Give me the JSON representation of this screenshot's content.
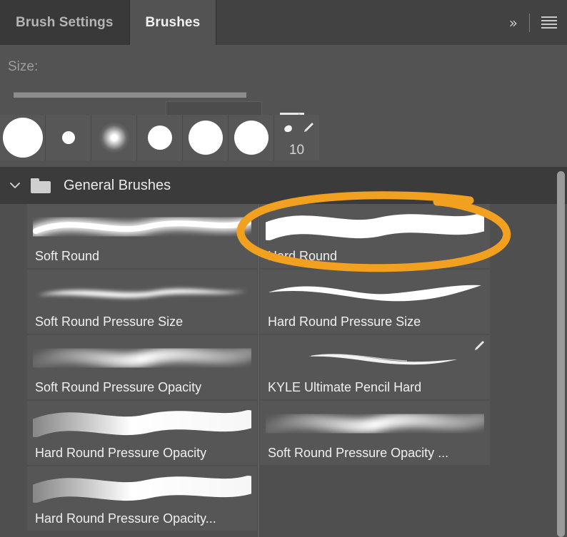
{
  "window": {
    "title": "Brushes",
    "bg_color": "#535353",
    "tabbar_color": "#424242"
  },
  "tabs": [
    {
      "label": "Brush Settings",
      "active": false
    },
    {
      "label": "Brushes",
      "active": true
    }
  ],
  "tab_tools": {
    "collapse_label": "»",
    "collapse_icon": "double-chevron-right-icon",
    "menu_icon": "hamburger-menu-icon"
  },
  "size_row": {
    "label": "Size:",
    "value": "",
    "placeholder": "",
    "slider_value": 100,
    "brush_preview_icon": "brush-preview-icon"
  },
  "preset_thumbs": [
    {
      "name": "hard-round-large",
      "kind": "hard",
      "diameter": 56,
      "label": ""
    },
    {
      "name": "hard-round-tiny",
      "kind": "hard",
      "diameter": 18,
      "label": ""
    },
    {
      "name": "soft-round",
      "kind": "soft",
      "diameter": 44,
      "label": ""
    },
    {
      "name": "hard-round-medium",
      "kind": "hard",
      "diameter": 34,
      "label": ""
    },
    {
      "name": "hard-round-big",
      "kind": "hard",
      "diameter": 48,
      "label": ""
    },
    {
      "name": "hard-round-big-2",
      "kind": "hard",
      "diameter": 48,
      "label": ""
    },
    {
      "name": "brush-size-10",
      "kind": "dab",
      "diameter": 0,
      "label": "10"
    }
  ],
  "group": {
    "expanded": true,
    "chevron_icon": "chevron-down-icon",
    "folder_icon": "folder-icon",
    "name": "General Brushes"
  },
  "brushes": [
    {
      "name": "Soft Round",
      "stroke": "soft",
      "badge": false
    },
    {
      "name": "Hard Round",
      "stroke": "hard",
      "badge": false
    },
    {
      "name": "Soft Round Pressure Size",
      "stroke": "soft-taper",
      "badge": false
    },
    {
      "name": "Hard Round Pressure Size",
      "stroke": "hard-taper",
      "badge": false
    },
    {
      "name": "Soft Round Pressure Opacity",
      "stroke": "soft-op",
      "badge": false
    },
    {
      "name": "KYLE Ultimate Pencil Hard",
      "stroke": "pencil",
      "badge": true
    },
    {
      "name": "Hard Round Pressure Opacity",
      "stroke": "hard-op",
      "badge": false
    },
    {
      "name": "Soft Round Pressure Opacity ...",
      "stroke": "soft-op2",
      "badge": false
    },
    {
      "name": "Hard Round Pressure Opacity...",
      "stroke": "hard-op2",
      "badge": false
    }
  ],
  "annotation": {
    "shape": "ellipse",
    "color": "#F2A020",
    "target": "Hard Round"
  },
  "scrollbar": {
    "name": "vertical-scrollbar",
    "color": "#9a9a9a"
  }
}
